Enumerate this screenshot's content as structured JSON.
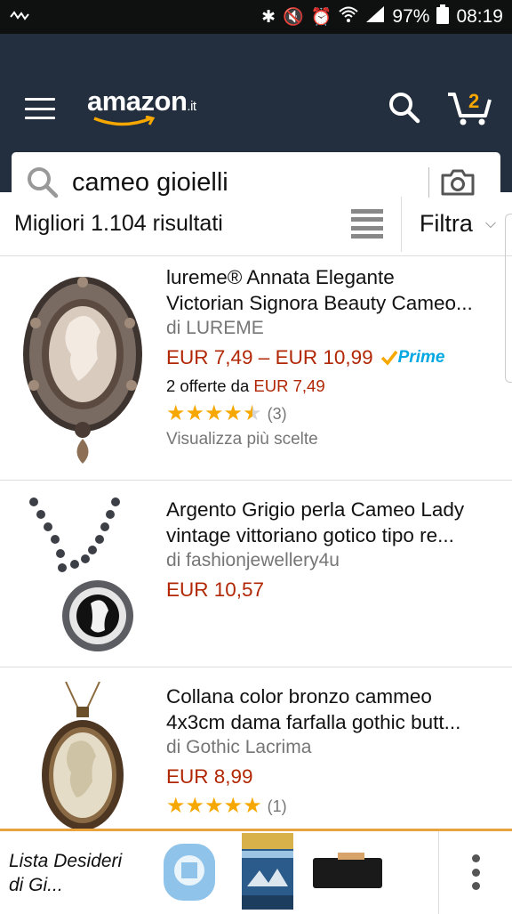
{
  "status_bar": {
    "battery": "97%",
    "time": "08:19"
  },
  "header": {
    "logo_text": "amazon",
    "logo_suffix": ".it",
    "cart_count": "2"
  },
  "search": {
    "query": "cameo gioielli"
  },
  "results_bar": {
    "count_text": "Migliori 1.104 risultati",
    "filter_label": "Filtra"
  },
  "results": [
    {
      "title_line1": "lureme® Annata Elegante",
      "title_line2": "Victorian Signora Beauty Cameo...",
      "brand": "di LUREME",
      "price": "EUR 7,49 – EUR 10,99",
      "prime": "Prime",
      "offers_prefix": "2 offerte da ",
      "offers_price": "EUR 7,49",
      "rating": 4.5,
      "reviews": "(3)",
      "more_link": "Visualizza più scelte"
    },
    {
      "title_line1": "Argento Grigio perla Cameo Lady",
      "title_line2": "vintage vittoriano gotico tipo re...",
      "brand": "di fashionjewellery4u",
      "price": "EUR 10,57"
    },
    {
      "title_line1": "Collana color bronzo cammeo",
      "title_line2": "4x3cm dama farfalla gothic butt...",
      "brand": "di Gothic Lacrima",
      "price": "EUR 8,99",
      "rating": 5,
      "reviews": "(1)"
    }
  ],
  "bottom_bar": {
    "wishlist_line1": "Lista Desideri",
    "wishlist_line2": "di Gi..."
  },
  "colors": {
    "header_bg": "#232f3e",
    "price": "#b12704",
    "star": "#f7a800",
    "prime": "#00a8e1",
    "accent": "#e8a33d"
  }
}
